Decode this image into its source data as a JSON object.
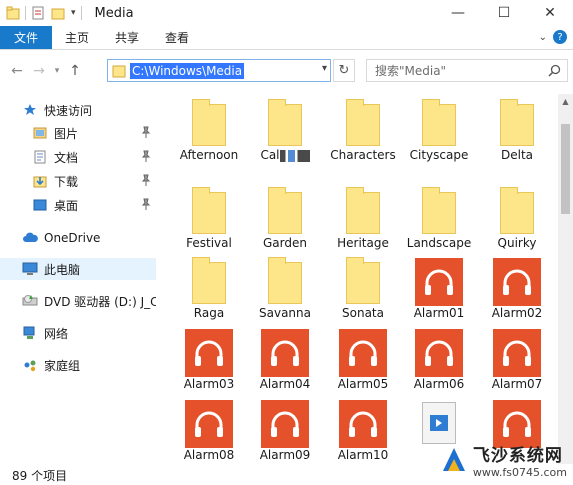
{
  "window": {
    "title": "Media",
    "minimize": "—",
    "maximize": "☐",
    "close": "✕"
  },
  "ribbon": {
    "tabs": [
      "文件",
      "主页",
      "共享",
      "查看"
    ]
  },
  "address": {
    "path": "C:\\Windows\\Media",
    "search_placeholder": "搜索\"Media\""
  },
  "nav": {
    "quick_access": "快速访问",
    "pictures": "图片",
    "documents": "文档",
    "downloads": "下载",
    "desktop": "桌面",
    "onedrive": "OneDrive",
    "this_pc": "此电脑",
    "dvd": "DVD 驱动器 (D:) J_C",
    "network": "网络",
    "homegroup": "家庭组"
  },
  "files": {
    "folders": [
      "Afternoon",
      "Cal",
      "Characters",
      "Cityscape",
      "Delta",
      "Festival",
      "Garden",
      "Heritage",
      "Landscape",
      "Quirky",
      "Raga",
      "Savanna",
      "Sonata"
    ],
    "audio": [
      "Alarm01",
      "Alarm02",
      "Alarm03",
      "Alarm04",
      "Alarm05",
      "Alarm06",
      "Alarm07",
      "Alarm08",
      "Alarm09",
      "Alarm10"
    ]
  },
  "status": {
    "count": "89 个项目"
  },
  "watermark": {
    "name": "飞沙系统网",
    "url": "www.fs0745.com"
  },
  "colors": {
    "accent": "#1979ca",
    "folder": "#fde68a",
    "audio": "#e4512b"
  }
}
